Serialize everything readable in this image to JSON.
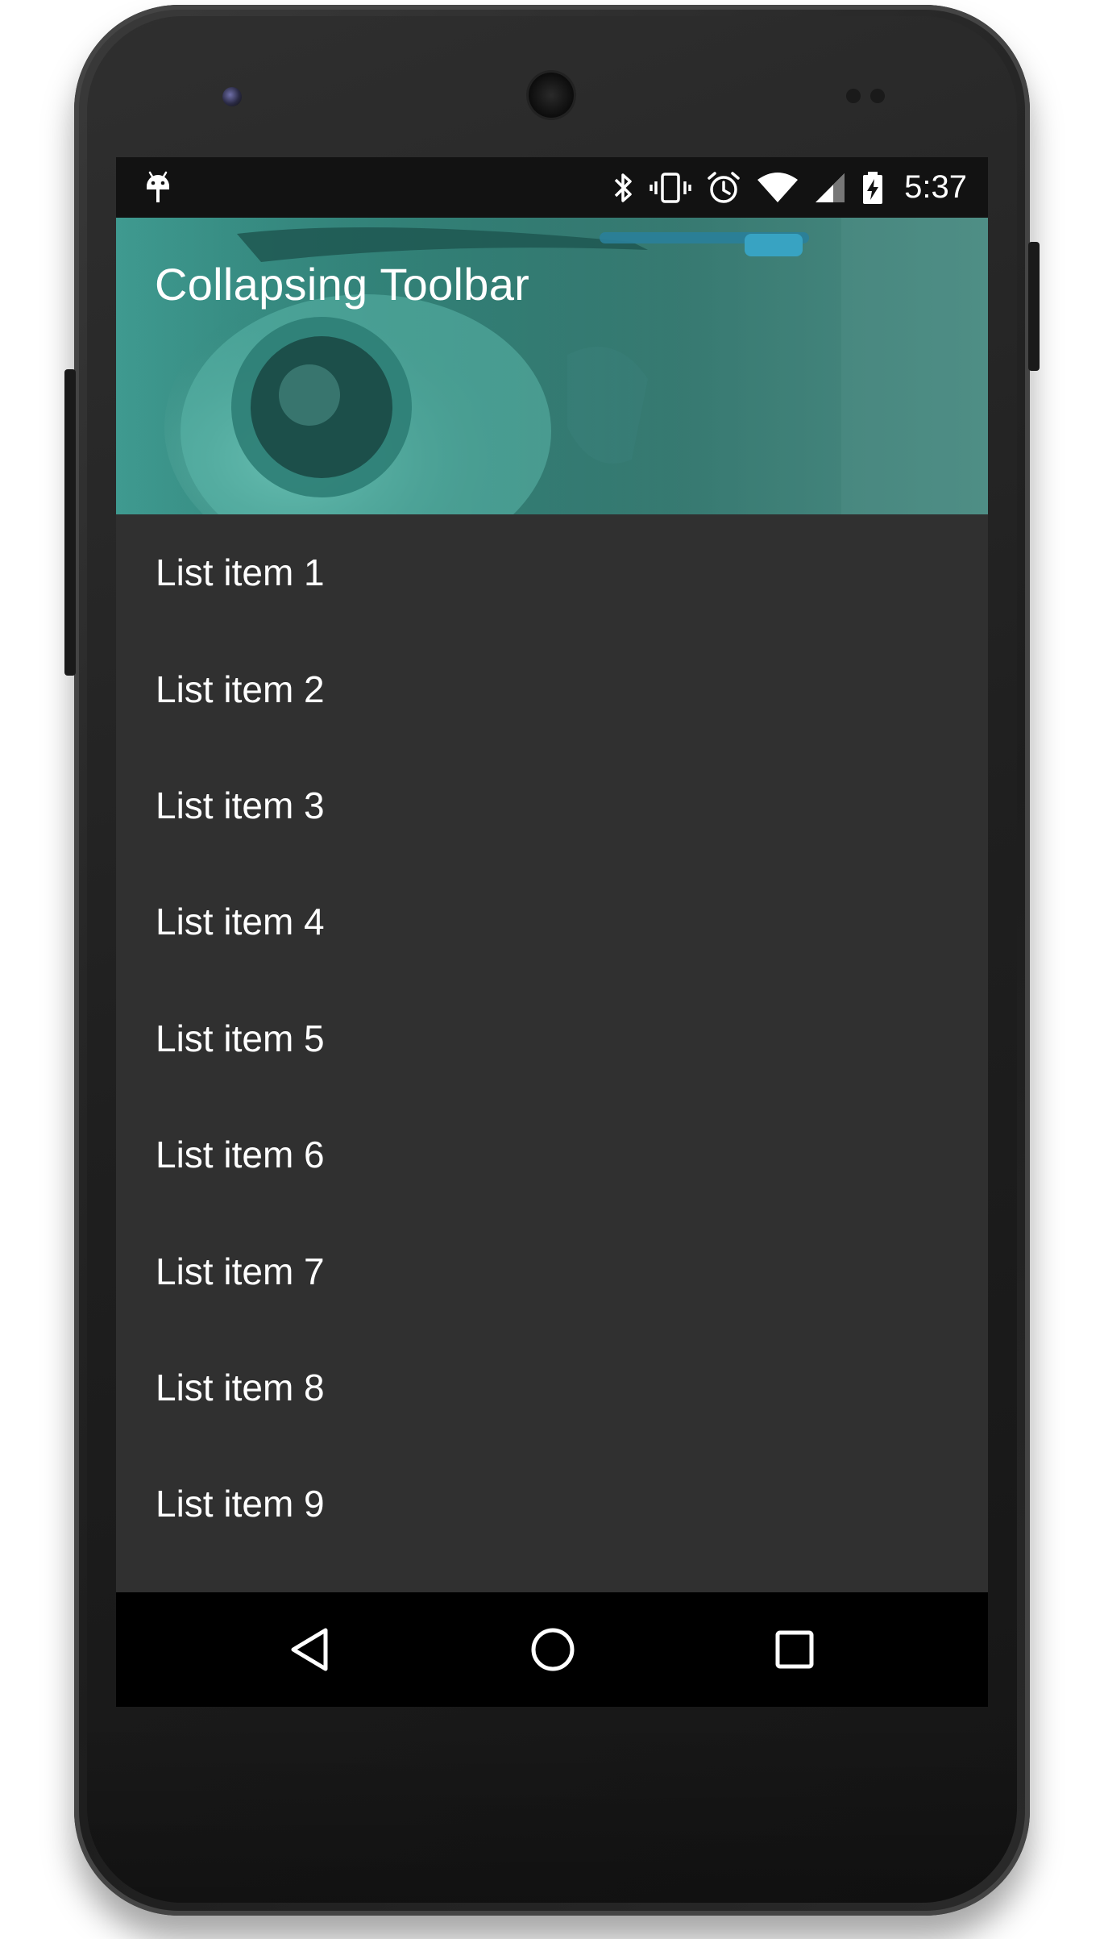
{
  "status_bar": {
    "time": "5:37",
    "left_icon": "android-debug-icon",
    "icons": [
      "bluetooth-icon",
      "vibrate-icon",
      "alarm-icon",
      "wifi-icon",
      "cell-signal-icon",
      "battery-charging-icon"
    ]
  },
  "app_bar": {
    "title": "Collapsing Toolbar",
    "accent": "#2f8278"
  },
  "list": {
    "items": [
      {
        "label": "List item 1"
      },
      {
        "label": "List item 2"
      },
      {
        "label": "List item 3"
      },
      {
        "label": "List item 4"
      },
      {
        "label": "List item 5"
      },
      {
        "label": "List item 6"
      },
      {
        "label": "List item 7"
      },
      {
        "label": "List item 8"
      },
      {
        "label": "List item 9"
      }
    ]
  },
  "nav_bar": {
    "buttons": [
      "back-icon",
      "home-icon",
      "recents-icon"
    ]
  },
  "colors": {
    "screen_background": "#303030",
    "status_bar": "#121212",
    "nav_bar": "#000000",
    "text": "#ffffff"
  }
}
